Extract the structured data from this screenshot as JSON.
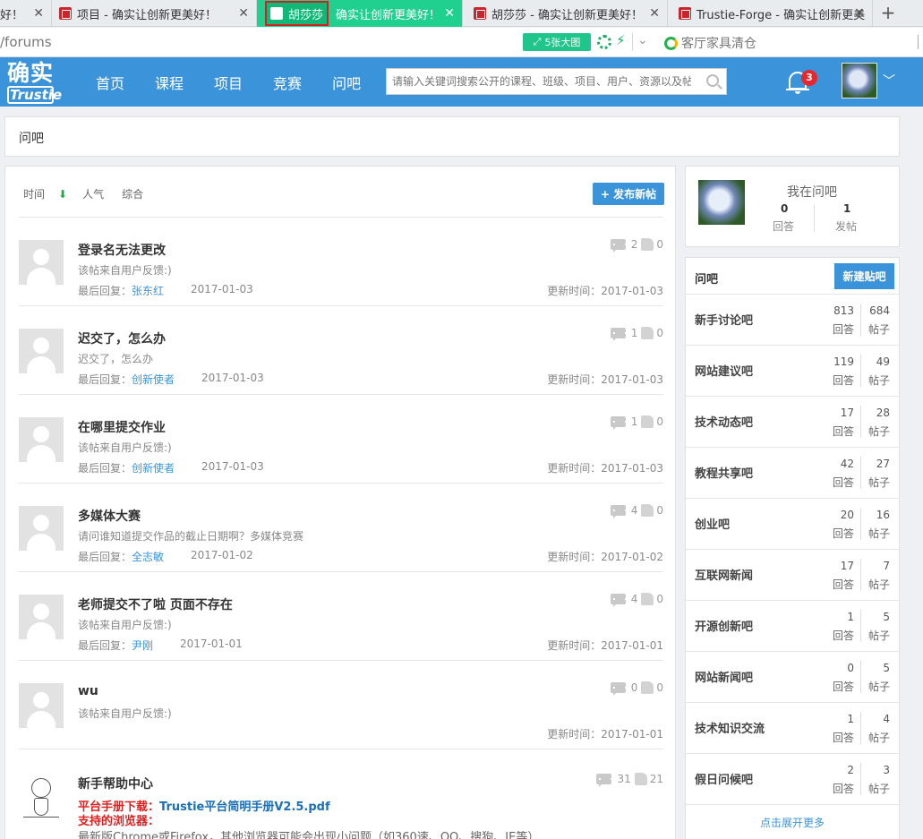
{
  "browser": {
    "tabs": [
      {
        "label": "好！"
      },
      {
        "label": "项目 - 确实让创新更美好！"
      },
      {
        "label_highlight": "胡莎莎",
        "label": "确实让创新更美好！"
      },
      {
        "label": "胡莎莎 - 确实让创新更美好！"
      },
      {
        "label": "Trustie-Forge - 确实让创新更美"
      }
    ],
    "close_glyph": "✕",
    "new_tab_glyph": "+",
    "url": "/forums",
    "image_button": "5张大图",
    "search_hint": "客厅家具清仓"
  },
  "header": {
    "logo_top": "确实",
    "logo_bottom": "Trustie",
    "nav": [
      "首页",
      "课程",
      "项目",
      "竞赛",
      "问吧"
    ],
    "search_placeholder": "请输入关键词搜索公开的课程、班级、项目、用户、资源以及帖子",
    "notification_count": "3",
    "brand_color": "#3b94d9"
  },
  "breadcrumb": "问吧",
  "sortbar": {
    "time": "时间",
    "arrow": "⬇",
    "popular": "人气",
    "overall": "综合"
  },
  "new_post_button": "+ 发布新帖",
  "labels": {
    "last_reply": "最后回复：",
    "updated": "更新时间："
  },
  "posts": [
    {
      "title": "登录名无法更改",
      "subtitle": "该帖来自用户反馈:)",
      "last_reply_user": "张东红",
      "last_reply_date": "2017-01-03",
      "updated": "2017-01-03",
      "comments": "2",
      "likes": "0"
    },
    {
      "title": "迟交了，怎么办",
      "subtitle": "迟交了，怎么办",
      "last_reply_user": "创新使者",
      "last_reply_date": "2017-01-03",
      "updated": "2017-01-03",
      "comments": "1",
      "likes": "0"
    },
    {
      "title": "在哪里提交作业",
      "subtitle": "该帖来自用户反馈:)",
      "last_reply_user": "创新使者",
      "last_reply_date": "2017-01-03",
      "updated": "2017-01-03",
      "comments": "1",
      "likes": "0"
    },
    {
      "title": "多媒体大赛",
      "subtitle": "请问谁知道提交作品的截止日期啊？多媒体竞赛",
      "last_reply_user": "全志敏",
      "last_reply_date": "2017-01-02",
      "updated": "2017-01-02",
      "comments": "4",
      "likes": "0"
    },
    {
      "title": "老师提交不了啦 页面不存在",
      "subtitle": "该帖来自用户反馈:)",
      "last_reply_user": "尹刚",
      "last_reply_date": "2017-01-01",
      "updated": "2017-01-01",
      "comments": "4",
      "likes": "0"
    },
    {
      "title": "wu",
      "subtitle": "该帖来自用户反馈:)",
      "last_reply_user": "",
      "last_reply_date": "",
      "updated": "2017-01-01",
      "comments": "0",
      "likes": "0"
    }
  ],
  "help": {
    "title": "新手帮助中心",
    "manual_label": "平台手册下载：",
    "manual_link": "Trustie平台简明手册V2.5.pdf",
    "browser_label": "支持的浏览器：",
    "browser_text": "最新版Chrome或Firefox，其他浏览器可能会出现小问题（如360速、QQ、搜狗、IE等）",
    "comments": "31",
    "likes": "21"
  },
  "me": {
    "title": "我在问吧",
    "answers": "0",
    "answers_label": "回答",
    "posts": "1",
    "posts_label": "发帖"
  },
  "forums": {
    "heading": "问吧",
    "new_button": "新建贴吧",
    "reply_label": "回答",
    "post_label": "帖子",
    "items": [
      {
        "name": "新手讨论吧",
        "replies": "813",
        "posts": "684"
      },
      {
        "name": "网站建议吧",
        "replies": "119",
        "posts": "49"
      },
      {
        "name": "技术动态吧",
        "replies": "17",
        "posts": "28"
      },
      {
        "name": "教程共享吧",
        "replies": "42",
        "posts": "27"
      },
      {
        "name": "创业吧",
        "replies": "20",
        "posts": "16"
      },
      {
        "name": "互联网新闻",
        "replies": "17",
        "posts": "7"
      },
      {
        "name": "开源创新吧",
        "replies": "1",
        "posts": "5"
      },
      {
        "name": "网站新闻吧",
        "replies": "0",
        "posts": "5"
      },
      {
        "name": "技术知识交流",
        "replies": "1",
        "posts": "4"
      },
      {
        "name": "假日问候吧",
        "replies": "2",
        "posts": "3"
      }
    ],
    "show_more": "点击展开更多"
  }
}
